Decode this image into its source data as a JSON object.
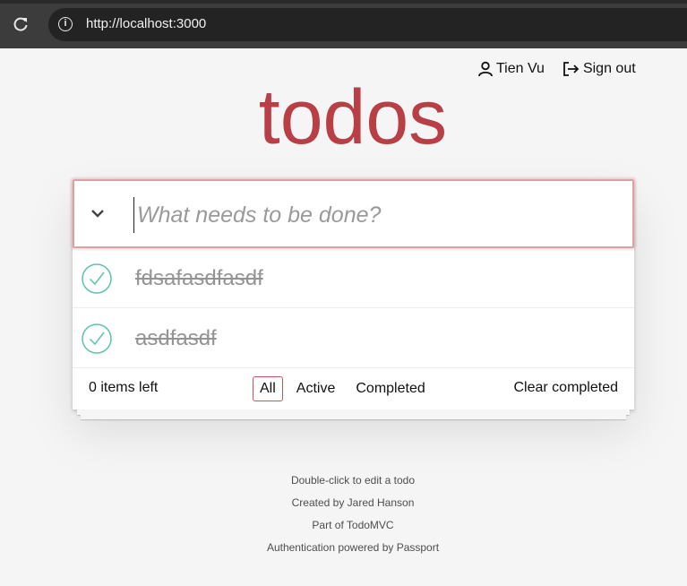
{
  "browser": {
    "url": "http://localhost:3000",
    "reload_icon": "reload-icon",
    "info_icon": "info-icon"
  },
  "user_nav": {
    "user_name": "Tien Vu",
    "user_icon": "user-icon",
    "signout_label": "Sign out",
    "signout_icon": "sign-out-icon"
  },
  "app": {
    "title": "todos",
    "accent_color": "#b83f45"
  },
  "new_todo": {
    "placeholder": "What needs to be done?",
    "value": "",
    "toggle_icon": "chevron-down-icon"
  },
  "todos": [
    {
      "text": "fdsafasdfasdf",
      "completed": true
    },
    {
      "text": "asdfasdf",
      "completed": true
    }
  ],
  "footer": {
    "count_text": "0 items left",
    "filters": [
      "All",
      "Active",
      "Completed"
    ],
    "selected_filter": "All",
    "clear_label": "Clear completed"
  },
  "info": {
    "line1": "Double-click to edit a todo",
    "line2": "Created by Jared Hanson",
    "line3": "Part of TodoMVC",
    "line4": "Authentication powered by Passport"
  }
}
